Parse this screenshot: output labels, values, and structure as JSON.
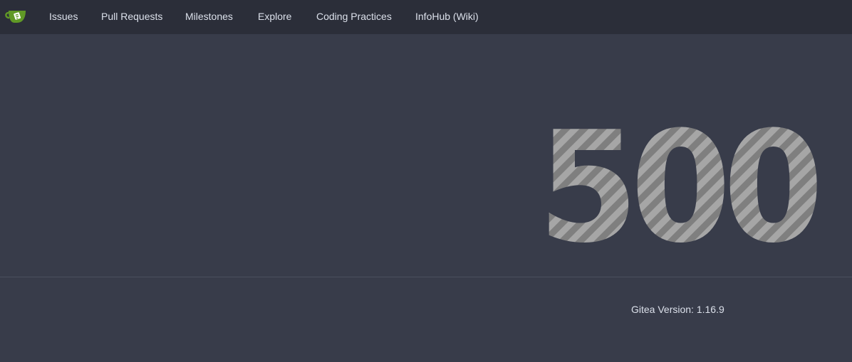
{
  "nav": {
    "items": [
      {
        "label": "Issues"
      },
      {
        "label": "Pull Requests"
      },
      {
        "label": "Milestones"
      },
      {
        "label": "Explore"
      },
      {
        "label": "Coding Practices"
      },
      {
        "label": "InfoHub (Wiki)"
      }
    ]
  },
  "error": {
    "code": "500"
  },
  "footer": {
    "version_label": "Gitea Version:",
    "version_value": "1.16.9"
  },
  "colors": {
    "navbar_bg": "#2b2e39",
    "page_bg": "#383c4a",
    "text": "#dbe0ea",
    "logo_green": "#609926",
    "stripe_light": "#a6a6a6",
    "stripe_dark": "#7f7f7f"
  },
  "icons": {
    "logo": "gitea-tea-cup-icon"
  }
}
